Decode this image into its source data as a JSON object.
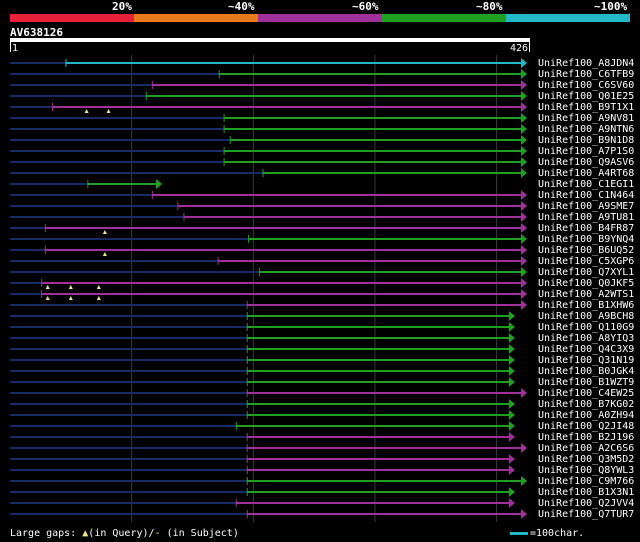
{
  "scale": {
    "labels": [
      "20%",
      "~40%",
      "~60%",
      "~80%",
      "~100%"
    ],
    "colors": [
      "#e8203a",
      "#e87a1c",
      "#a0309a",
      "#20a020",
      "#22b8c8"
    ]
  },
  "query": {
    "id": "AV638126",
    "start": "1",
    "end": "426",
    "length": 426
  },
  "hits": [
    {
      "name": "UniRef100_A8JDN4",
      "color": "cyan",
      "seg": [
        47,
        426
      ],
      "dark": [
        1,
        47
      ]
    },
    {
      "name": "UniRef100_C6TFB9",
      "color": "green",
      "seg": [
        173,
        426
      ],
      "dark": [
        1,
        173
      ]
    },
    {
      "name": "UniRef100_C6SV60",
      "color": "magenta",
      "seg": [
        118,
        426
      ],
      "dark": [
        1,
        118
      ]
    },
    {
      "name": "UniRef100_Q01E25",
      "color": "green",
      "seg": [
        113,
        426
      ],
      "dark": [
        1,
        113
      ]
    },
    {
      "name": "UniRef100_B9T1X1",
      "color": "magenta",
      "seg": [
        36,
        426
      ],
      "dark": [
        1,
        36
      ],
      "gaps": [
        64,
        82
      ]
    },
    {
      "name": "UniRef100_A9NV81",
      "color": "green",
      "seg": [
        177,
        426
      ],
      "dark": [
        1,
        177
      ]
    },
    {
      "name": "UniRef100_A9NTN6",
      "color": "green",
      "seg": [
        177,
        426
      ],
      "dark": [
        1,
        177
      ]
    },
    {
      "name": "UniRef100_B9N1D8",
      "color": "green",
      "seg": [
        182,
        426
      ],
      "dark": [
        1,
        182
      ]
    },
    {
      "name": "UniRef100_A7P1S0",
      "color": "green",
      "seg": [
        177,
        426
      ],
      "dark": [
        1,
        177
      ]
    },
    {
      "name": "UniRef100_Q9ASV6",
      "color": "green",
      "seg": [
        177,
        426
      ],
      "dark": [
        1,
        177
      ]
    },
    {
      "name": "UniRef100_A4RT68",
      "color": "green",
      "seg": [
        209,
        426
      ],
      "dark": [
        1,
        209
      ]
    },
    {
      "name": "UniRef100_C1EGI1",
      "color": "green",
      "seg": [
        65,
        126
      ],
      "dark": [
        1,
        65
      ]
    },
    {
      "name": "UniRef100_C1N464",
      "color": "magenta",
      "seg": [
        118,
        426
      ],
      "dark": [
        1,
        118
      ]
    },
    {
      "name": "UniRef100_A9SME7",
      "color": "magenta",
      "seg": [
        139,
        426
      ],
      "dark": [
        1,
        139
      ]
    },
    {
      "name": "UniRef100_A9TU81",
      "color": "magenta",
      "seg": [
        144,
        426
      ],
      "dark": [
        1,
        144
      ]
    },
    {
      "name": "UniRef100_B4FR87",
      "color": "magenta",
      "seg": [
        30,
        426
      ],
      "dark": [
        1,
        30
      ],
      "gaps": [
        79
      ]
    },
    {
      "name": "UniRef100_B9YNQ4",
      "color": "green",
      "seg": [
        197,
        426
      ],
      "dark": [
        1,
        197
      ]
    },
    {
      "name": "UniRef100_B6UQ52",
      "color": "magenta",
      "seg": [
        30,
        426
      ],
      "dark": [
        1,
        30
      ],
      "gaps": [
        79
      ]
    },
    {
      "name": "UniRef100_C5XGP6",
      "color": "magenta",
      "seg": [
        172,
        426
      ],
      "dark": [
        1,
        172
      ]
    },
    {
      "name": "UniRef100_Q7XYL1",
      "color": "green",
      "seg": [
        206,
        426
      ],
      "dark": [
        1,
        206
      ]
    },
    {
      "name": "UniRef100_Q0JKF5",
      "color": "magenta",
      "seg": [
        27,
        426
      ],
      "dark": [
        1,
        27
      ],
      "gaps": [
        32,
        51,
        74
      ]
    },
    {
      "name": "UniRef100_A2WTS1",
      "color": "magenta",
      "seg": [
        27,
        426
      ],
      "dark": [
        1,
        27
      ],
      "gaps": [
        32,
        51,
        74
      ]
    },
    {
      "name": "UniRef100_B1XHW6",
      "color": "magenta",
      "seg": [
        196,
        426
      ],
      "dark": [
        1,
        196
      ]
    },
    {
      "name": "UniRef100_A9BCH8",
      "color": "green",
      "seg": [
        196,
        416
      ],
      "dark": [
        1,
        196
      ]
    },
    {
      "name": "UniRef100_Q110G9",
      "color": "green",
      "seg": [
        196,
        416
      ],
      "dark": [
        1,
        196
      ]
    },
    {
      "name": "UniRef100_A8YIQ3",
      "color": "green",
      "seg": [
        196,
        416
      ],
      "dark": [
        1,
        196
      ]
    },
    {
      "name": "UniRef100_Q4C3X9",
      "color": "green",
      "seg": [
        196,
        416
      ],
      "dark": [
        1,
        196
      ]
    },
    {
      "name": "UniRef100_Q31N19",
      "color": "green",
      "seg": [
        196,
        416
      ],
      "dark": [
        1,
        196
      ]
    },
    {
      "name": "UniRef100_B0JGK4",
      "color": "green",
      "seg": [
        196,
        416
      ],
      "dark": [
        1,
        196
      ]
    },
    {
      "name": "UniRef100_B1WZT9",
      "color": "green",
      "seg": [
        196,
        416
      ],
      "dark": [
        1,
        196
      ]
    },
    {
      "name": "UniRef100_C4EW25",
      "color": "magenta",
      "seg": [
        196,
        426
      ],
      "dark": [
        1,
        196
      ]
    },
    {
      "name": "UniRef100_B7KG02",
      "color": "green",
      "seg": [
        196,
        416
      ],
      "dark": [
        1,
        196
      ]
    },
    {
      "name": "UniRef100_A0ZH94",
      "color": "green",
      "seg": [
        196,
        416
      ],
      "dark": [
        1,
        196
      ]
    },
    {
      "name": "UniRef100_Q2JI48",
      "color": "green",
      "seg": [
        187,
        416
      ],
      "dark": [
        1,
        187
      ]
    },
    {
      "name": "UniRef100_B2J196",
      "color": "magenta",
      "seg": [
        196,
        416
      ],
      "dark": [
        1,
        196
      ]
    },
    {
      "name": "UniRef100_A2C6S6",
      "color": "magenta",
      "seg": [
        196,
        426
      ],
      "dark": [
        1,
        196
      ]
    },
    {
      "name": "UniRef100_Q3M5D2",
      "color": "magenta",
      "seg": [
        196,
        416
      ],
      "dark": [
        1,
        196
      ]
    },
    {
      "name": "UniRef100_Q8YWL3",
      "color": "magenta",
      "seg": [
        196,
        416
      ],
      "dark": [
        1,
        196
      ]
    },
    {
      "name": "UniRef100_C9M766",
      "color": "green",
      "seg": [
        196,
        426
      ],
      "dark": [
        1,
        196
      ]
    },
    {
      "name": "UniRef100_B1X3N1",
      "color": "green",
      "seg": [
        196,
        416
      ],
      "dark": [
        1,
        196
      ]
    },
    {
      "name": "UniRef100_Q2JVV4",
      "color": "magenta",
      "seg": [
        187,
        416
      ],
      "dark": [
        1,
        187
      ]
    },
    {
      "name": "UniRef100_Q7TUR7",
      "color": "magenta",
      "seg": [
        196,
        426
      ],
      "dark": [
        1,
        196
      ]
    }
  ],
  "legend": {
    "large_gaps": "Large gaps:",
    "in_query": "(in Query)/",
    "in_subject": "(in Subject)",
    "scale_text": "=100char."
  }
}
